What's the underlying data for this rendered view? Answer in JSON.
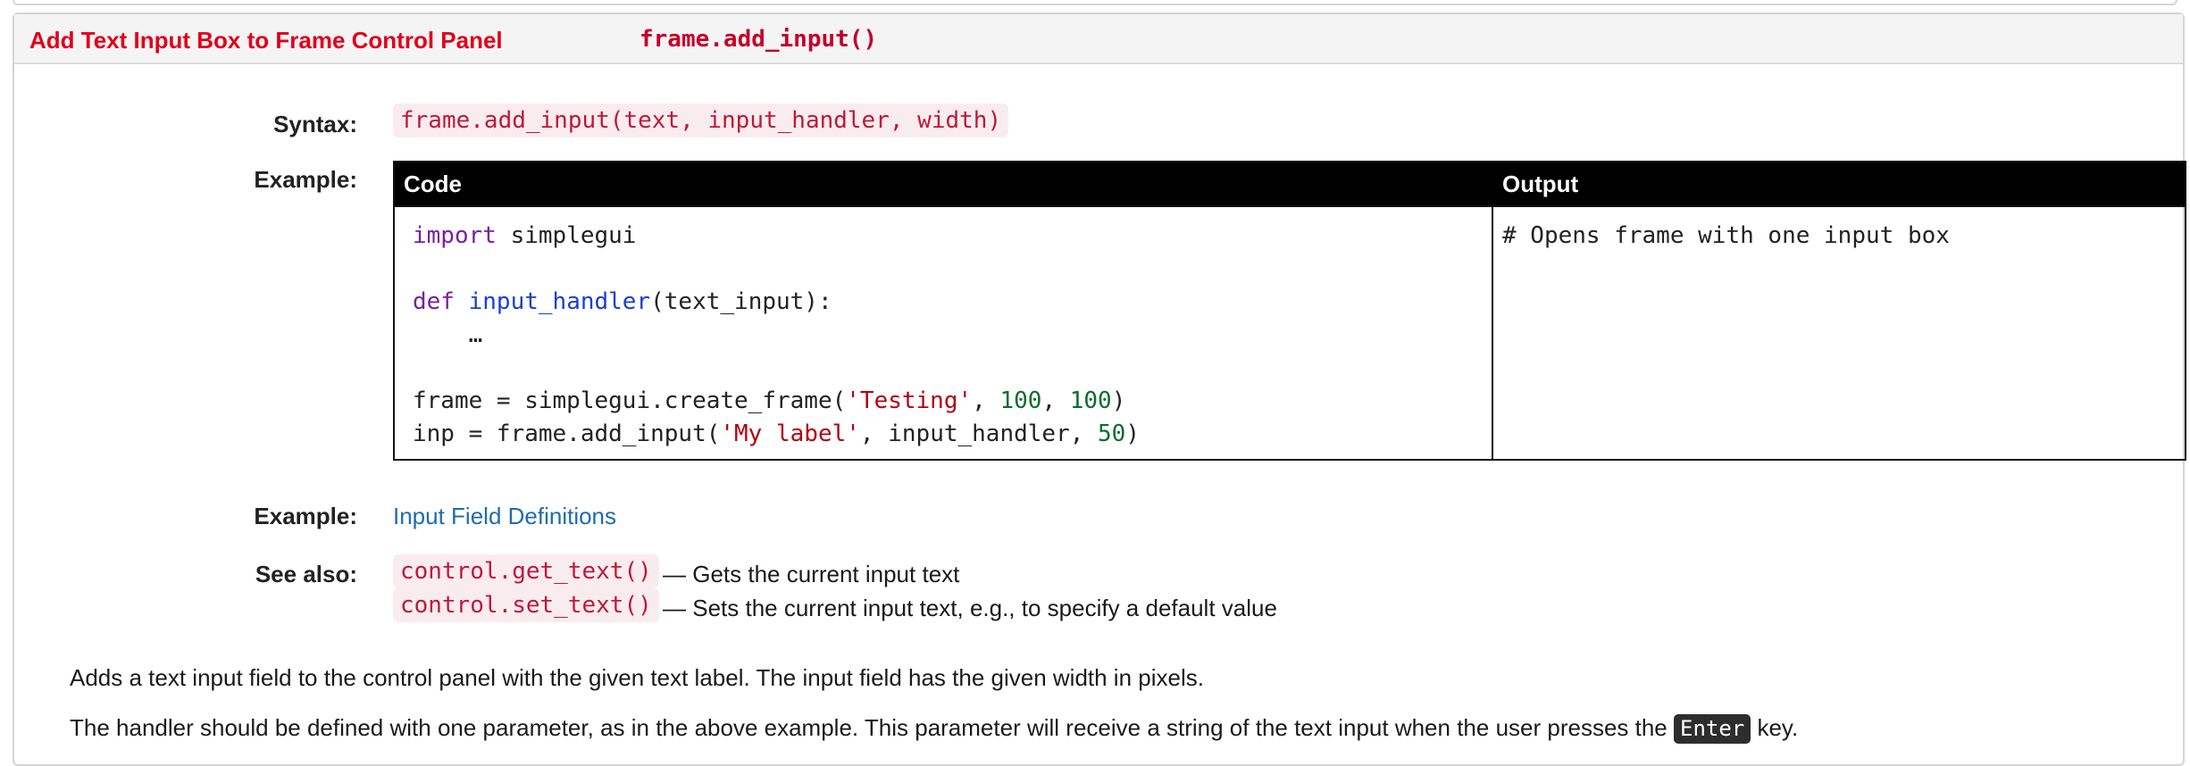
{
  "header": {
    "title": "Add Text Input Box to Frame Control Panel",
    "function_signature": "frame.add_input()"
  },
  "syntax": {
    "label": "Syntax:",
    "code": "frame.add_input(text, input_handler, width)"
  },
  "example_table": {
    "label": "Example:",
    "columns": [
      "Code",
      "Output"
    ],
    "code_lines": [
      [
        {
          "t": "import",
          "c": "kw"
        },
        {
          "t": " simplegui",
          "c": ""
        }
      ],
      [],
      [
        {
          "t": "def",
          "c": "kw"
        },
        {
          "t": " ",
          "c": ""
        },
        {
          "t": "input_handler",
          "c": "fn"
        },
        {
          "t": "(text_input):",
          "c": ""
        }
      ],
      [
        {
          "t": "    …",
          "c": ""
        }
      ],
      [],
      [
        {
          "t": "frame = simplegui.create_frame(",
          "c": ""
        },
        {
          "t": "'Testing'",
          "c": "str"
        },
        {
          "t": ", ",
          "c": ""
        },
        {
          "t": "100",
          "c": "num"
        },
        {
          "t": ", ",
          "c": ""
        },
        {
          "t": "100",
          "c": "num"
        },
        {
          "t": ")",
          "c": ""
        }
      ],
      [
        {
          "t": "inp = frame.add_input(",
          "c": ""
        },
        {
          "t": "'My label'",
          "c": "str"
        },
        {
          "t": ", input_handler, ",
          "c": ""
        },
        {
          "t": "50",
          "c": "num"
        },
        {
          "t": ")",
          "c": ""
        }
      ]
    ],
    "output_text": "# Opens frame with one input box"
  },
  "example_link": {
    "label": "Example:",
    "text": "Input Field Definitions"
  },
  "see_also": {
    "label": "See also:",
    "items": [
      {
        "code": "control.get_text()",
        "desc": "— Gets the current input text"
      },
      {
        "code": "control.set_text()",
        "desc": "— Sets the current input text, e.g., to specify a default value"
      }
    ]
  },
  "description": {
    "paragraph1": "Adds a text input field to the control panel with the given text label. The input field has the given width in pixels.",
    "paragraph2_before": "The handler should be defined with one parameter, as in the above example. This parameter will receive a string of the text input when the user presses the ",
    "paragraph2_key": "Enter",
    "paragraph2_after": " key."
  },
  "colors": {
    "header_title": "#e0001c",
    "code_chip_text": "#c0183a",
    "code_chip_bg": "#f9ecef",
    "link": "#1f6bb0",
    "table_header_bg": "#000000"
  }
}
